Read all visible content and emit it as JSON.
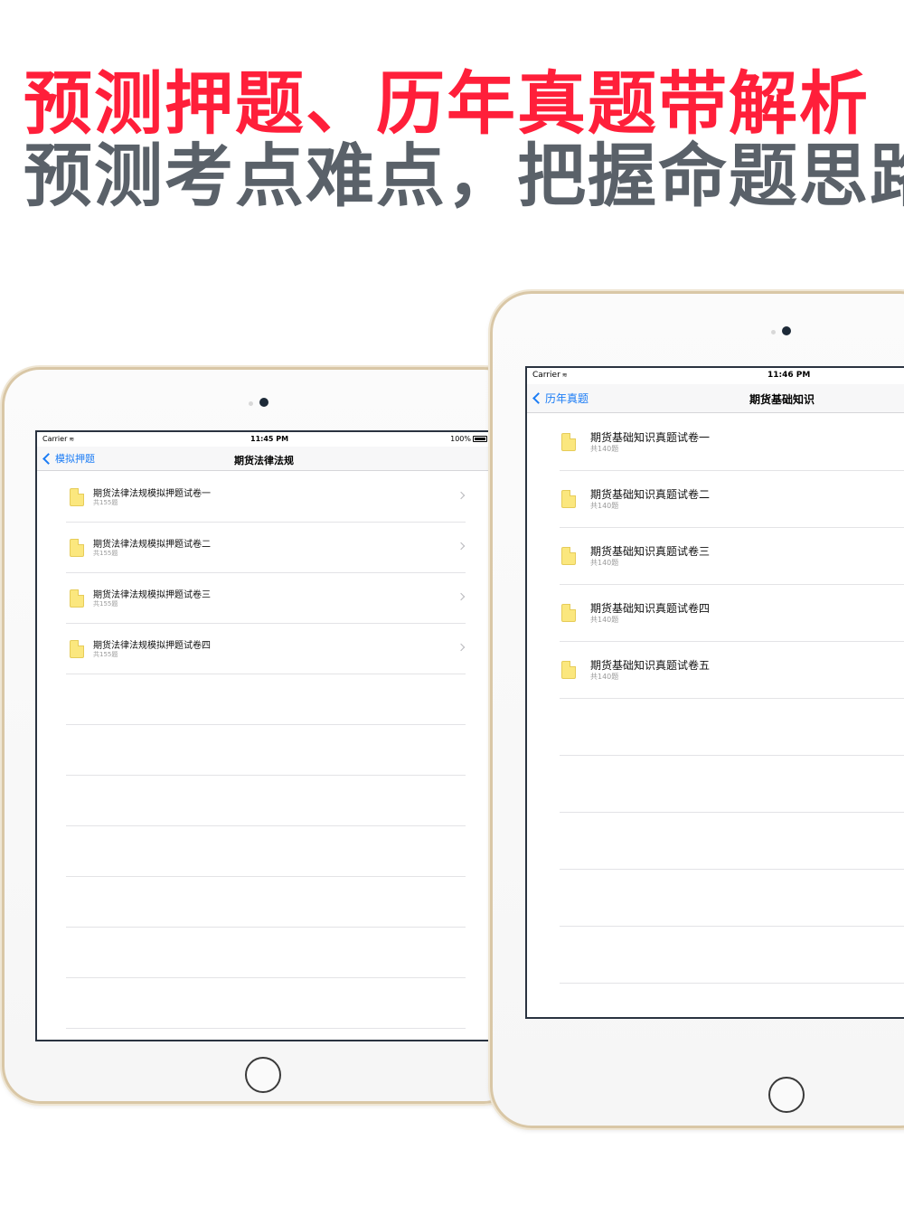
{
  "headline": {
    "line1": "预测押题、历年真题带解析",
    "line2": "预测考点难点，把握命题思路"
  },
  "colors": {
    "accent_red": "#ff1f3a",
    "text_gray": "#5a6169",
    "link_blue": "#1b7cf5",
    "folder_yellow": "#fbe77e"
  },
  "left_device": {
    "status": {
      "carrier": "Carrier",
      "time": "11:45 PM",
      "battery": "100%"
    },
    "nav": {
      "back_label": "模拟押题",
      "title": "期货法律法规"
    },
    "items": [
      {
        "title": "期货法律法规模拟押题试卷一",
        "subtitle": "共155题"
      },
      {
        "title": "期货法律法规模拟押题试卷二",
        "subtitle": "共155题"
      },
      {
        "title": "期货法律法规模拟押题试卷三",
        "subtitle": "共155题"
      },
      {
        "title": "期货法律法规模拟押题试卷四",
        "subtitle": "共155题"
      }
    ]
  },
  "right_device": {
    "status": {
      "carrier": "Carrier",
      "time": "11:46 PM"
    },
    "nav": {
      "back_label": "历年真题",
      "title": "期货基础知识"
    },
    "items": [
      {
        "title": "期货基础知识真题试卷一",
        "subtitle": "共140题"
      },
      {
        "title": "期货基础知识真题试卷二",
        "subtitle": "共140题"
      },
      {
        "title": "期货基础知识真题试卷三",
        "subtitle": "共140题"
      },
      {
        "title": "期货基础知识真题试卷四",
        "subtitle": "共140题"
      },
      {
        "title": "期货基础知识真题试卷五",
        "subtitle": "共140题"
      }
    ]
  },
  "icons": {
    "back": "chevron-left-icon",
    "row_icon": "document-icon",
    "row_accessory": "chevron-right-icon",
    "wifi": "wifi-icon",
    "battery": "battery-icon"
  }
}
